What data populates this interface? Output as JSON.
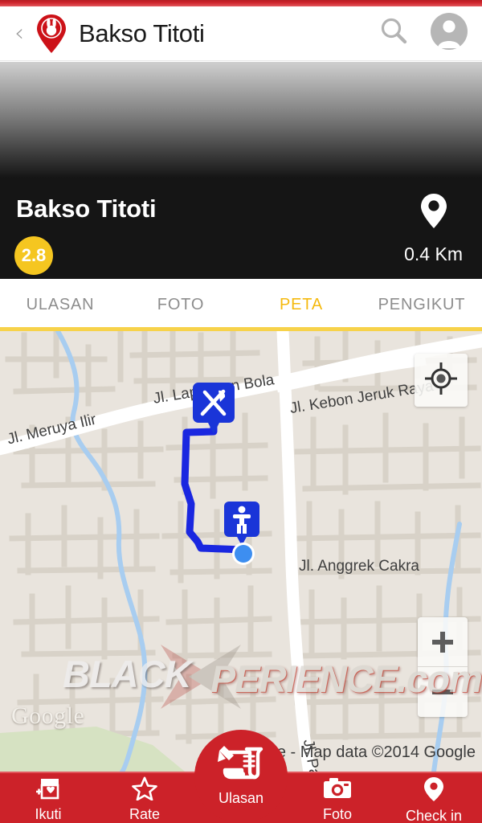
{
  "header": {
    "back_label": "‹",
    "logo_icon": "rabbit-pin-logo",
    "title": "Bakso Titoti",
    "search_icon": "search-icon",
    "avatar_icon": "avatar-icon"
  },
  "place": {
    "name": "Bakso Titoti",
    "rating": "2.8",
    "distance": "0.4 Km",
    "distance_icon": "location-pin-icon"
  },
  "tabs": [
    {
      "label": "ULASAN",
      "active": false
    },
    {
      "label": "FOTO",
      "active": false
    },
    {
      "label": "PETA",
      "active": true
    },
    {
      "label": "PENGIKUT",
      "active": false
    }
  ],
  "map": {
    "roads": [
      {
        "name": "Jl. Meruya Ilir"
      },
      {
        "name": "Jl. Lapangan Bola"
      },
      {
        "name": "Jl. Kebon Jeruk Raya"
      },
      {
        "name": "Jl. Anggrek Cakra"
      },
      {
        "name": "Jl. Panjang"
      }
    ],
    "markers": [
      {
        "type": "restaurant-marker",
        "icon": "fork-knife-icon"
      },
      {
        "type": "pedestrian-marker",
        "icon": "walking-person-icon"
      },
      {
        "type": "current-location-dot",
        "icon": "blue-dot-icon"
      }
    ],
    "my_location_icon": "crosshair-icon",
    "zoom_in_label": "+",
    "zoom_out_label": "−",
    "google_logo": "Google",
    "attribution": "e - Map data ©2014 Google",
    "watermark_part1": "BLACK",
    "watermark_part2": "PERIENCE.com",
    "route_color": "#1a27e0",
    "marker_color": "#1a35d8"
  },
  "bottomnav": [
    {
      "label": "Ikuti",
      "icon": "store-heart-icon"
    },
    {
      "label": "Rate",
      "icon": "star-icon"
    },
    {
      "label": "Ulasan",
      "icon": "review-pen-icon"
    },
    {
      "label": "Foto",
      "icon": "camera-icon"
    },
    {
      "label": "Check in",
      "icon": "location-pin-icon"
    }
  ],
  "colors": {
    "brand_red": "#cc2229",
    "accent_yellow": "#f5b90d",
    "rating_yellow": "#f5c620",
    "panel_black": "#151515",
    "map_bg": "#e8e3dc"
  }
}
